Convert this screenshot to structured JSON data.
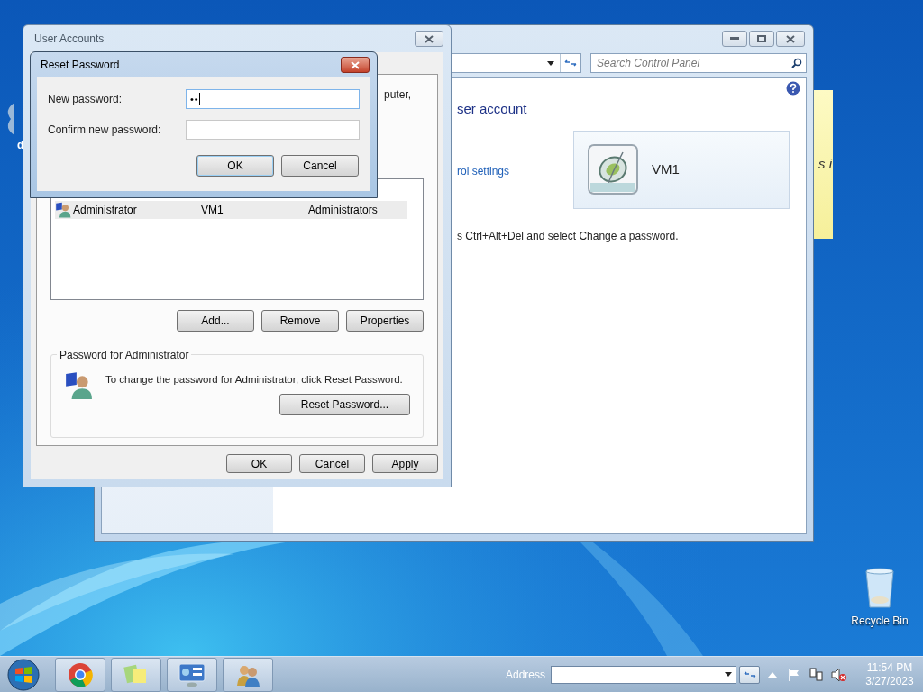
{
  "desktop": {
    "icons": [
      {
        "label": "d"
      },
      {
        "label": "Recycle Bin"
      }
    ],
    "sticky_note": {
      "text": "s i"
    }
  },
  "control_panel": {
    "search": {
      "placeholder": "Search Control Panel"
    },
    "heading": "ser account",
    "link": "rol settings",
    "account_tile": {
      "name": "VM1"
    },
    "hint": "s Ctrl+Alt+Del and select Change a password."
  },
  "user_accounts": {
    "title": "User Accounts",
    "intro_fragment": "puter,",
    "users": {
      "rows": [
        {
          "cells": [
            "Administrator",
            "VM1",
            "Administrators"
          ],
          "selected": true
        }
      ]
    },
    "list_buttons": [
      "Add...",
      "Remove",
      "Properties"
    ],
    "password_group": {
      "title": "Password for Administrator",
      "text": "To change the password for Administrator, click Reset Password.",
      "button": "Reset Password..."
    },
    "buttons": [
      "OK",
      "Cancel",
      "Apply"
    ]
  },
  "reset_password": {
    "title": "Reset Password",
    "fields": [
      {
        "label": "New password:",
        "value": "••",
        "focused": true
      },
      {
        "label": "Confirm new password:",
        "focused": false
      }
    ],
    "buttons": [
      {
        "label": "OK",
        "default": true
      },
      {
        "label": "Cancel",
        "default": false
      }
    ]
  },
  "taskbar": {
    "address_label": "Address",
    "clock": {
      "time": "11:54 PM",
      "date": "3/27/2023"
    }
  }
}
